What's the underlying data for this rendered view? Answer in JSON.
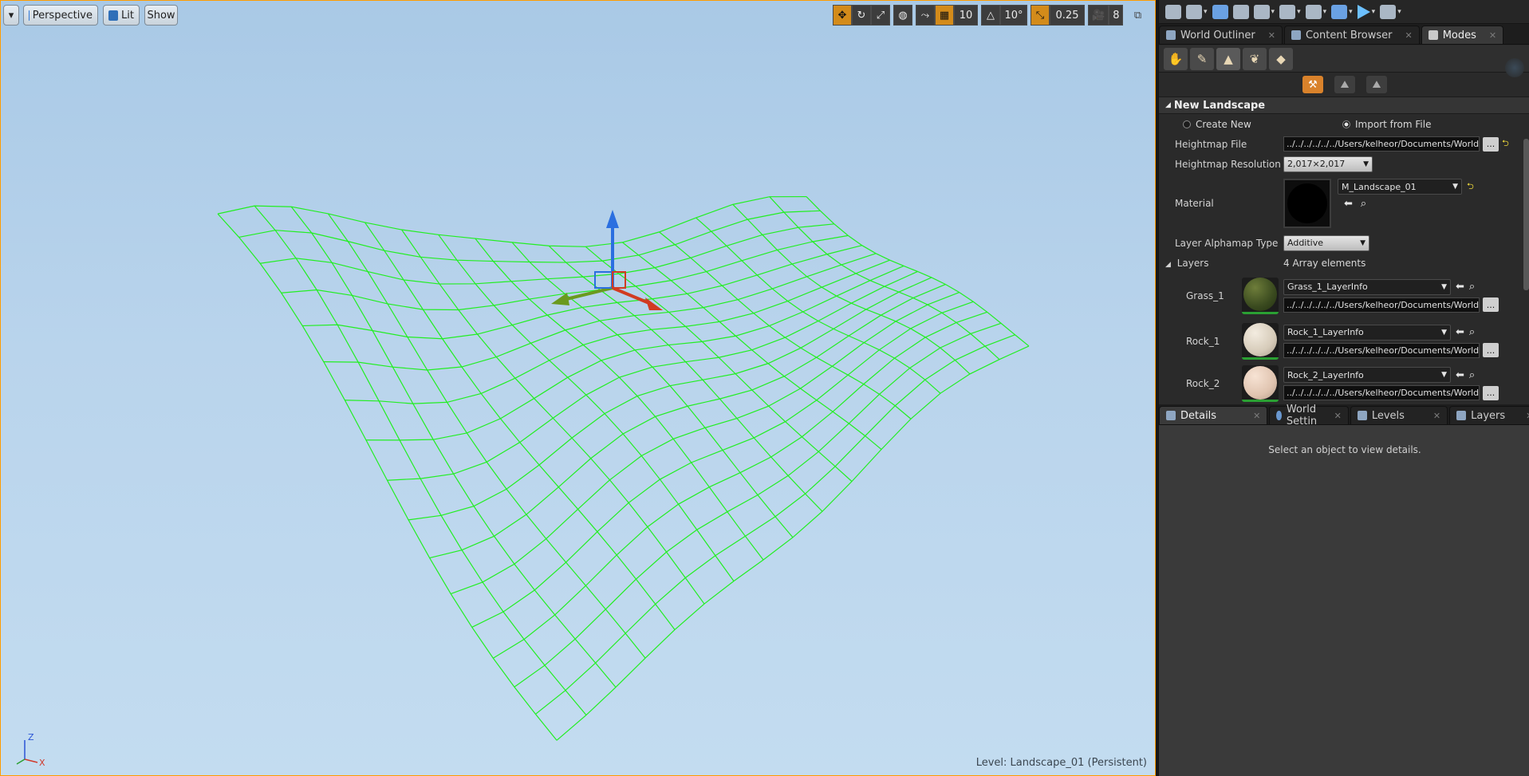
{
  "viewport": {
    "menu_caret": "▾",
    "perspective": "Perspective",
    "lit": "Lit",
    "show": "Show",
    "grid_snap": "10",
    "rot_snap": "10°",
    "scale_snap": "0.25",
    "cam_speed": "8",
    "level_prefix": "Level:",
    "level_name": "Landscape_01 (Persistent)",
    "axis_z": "Z",
    "axis_x": "X"
  },
  "tabs_top": [
    {
      "label": "World Outliner"
    },
    {
      "label": "Content Browser"
    },
    {
      "label": "Modes"
    }
  ],
  "modes": {
    "section_title": "New Landscape",
    "create_new": "Create New",
    "import_from_file": "Import from File",
    "heightmap_file_label": "Heightmap File",
    "heightmap_file_value": "../../../../../../Users/kelheor/Documents/World f",
    "heightmap_res_label": "Heightmap Resolution",
    "heightmap_res_value": "2,017×2,017",
    "material_label": "Material",
    "material_value": "M_Landscape_01",
    "alphamap_label": "Layer Alphamap Type",
    "alphamap_value": "Additive",
    "layers_label": "Layers",
    "layers_count": "4 Array elements",
    "browse": "...",
    "layers": [
      {
        "name": "Grass_1",
        "info": "Grass_1_LayerInfo",
        "path": "../../../../../../Users/kelheor/Documents/World f"
      },
      {
        "name": "Rock_1",
        "info": "Rock_1_LayerInfo",
        "path": "../../../../../../Users/kelheor/Documents/World f"
      },
      {
        "name": "Rock_2",
        "info": "Rock_2_LayerInfo",
        "path": "../../../../../../Users/kelheor/Documents/World f"
      }
    ]
  },
  "tabs_bottom": [
    {
      "label": "Details"
    },
    {
      "label": "World Settin"
    },
    {
      "label": "Levels"
    },
    {
      "label": "Layers"
    }
  ],
  "details": {
    "empty_text": "Select an object to view details."
  },
  "colors": {
    "wireframe": "#22ee22",
    "accent": "#ff9c00"
  }
}
